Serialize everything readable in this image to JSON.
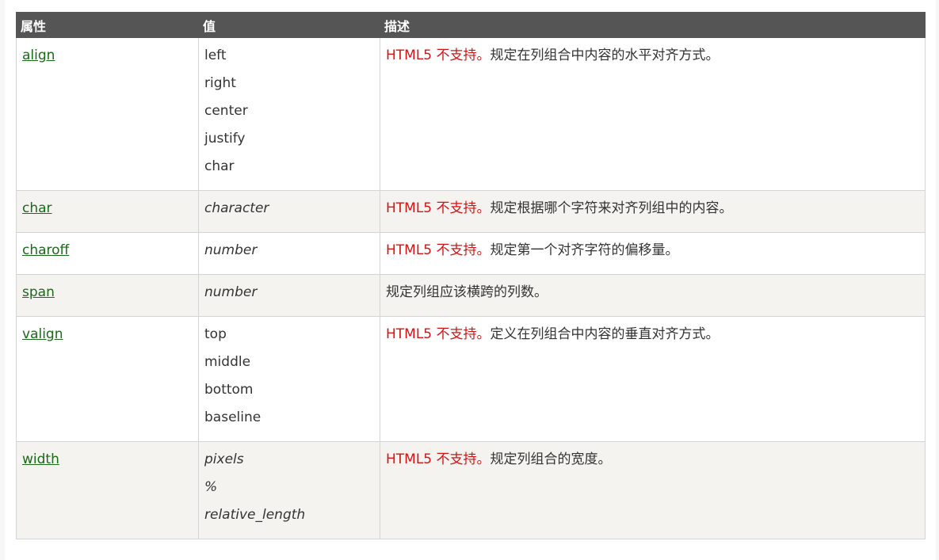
{
  "headers": [
    "属性",
    "值",
    "描述"
  ],
  "unsupported_text": "HTML5 不支持。",
  "rows": [
    {
      "attr": "align",
      "values": [
        "left",
        "right",
        "center",
        "justify",
        "char"
      ],
      "italic": false,
      "unsupported": true,
      "desc": "规定在列组合中内容的水平对齐方式。"
    },
    {
      "attr": "char",
      "values": [
        "character"
      ],
      "italic": true,
      "unsupported": true,
      "desc": "规定根据哪个字符来对齐列组中的内容。"
    },
    {
      "attr": "charoff",
      "values": [
        "number"
      ],
      "italic": true,
      "unsupported": true,
      "desc": "规定第一个对齐字符的偏移量。"
    },
    {
      "attr": "span",
      "values": [
        "number"
      ],
      "italic": true,
      "unsupported": false,
      "desc": "规定列组应该横跨的列数。"
    },
    {
      "attr": "valign",
      "values": [
        "top",
        "middle",
        "bottom",
        "baseline"
      ],
      "italic": false,
      "unsupported": true,
      "desc": "定义在列组合中内容的垂直对齐方式。"
    },
    {
      "attr": "width",
      "values": [
        "pixels",
        "%",
        "relative_length"
      ],
      "italic": true,
      "unsupported": true,
      "desc": "规定列组合的宽度。"
    }
  ],
  "colors": {
    "header_bg": "#555555",
    "link": "#1a6a1a",
    "unsupported": "#d11515",
    "alt_row": "#f4f3ef",
    "border": "#d4d4d4"
  }
}
